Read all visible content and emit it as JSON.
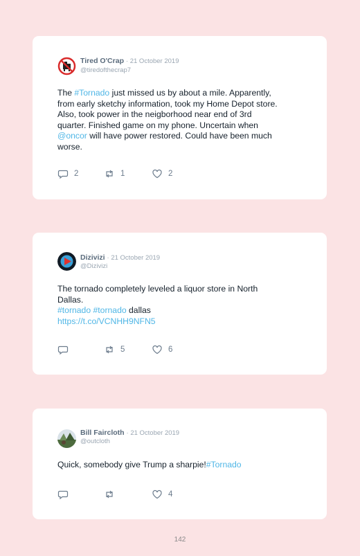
{
  "tweets": [
    {
      "name": "Tired O'Crap",
      "date": "· 21 October 2019",
      "handle": "@tiredofthecrap7",
      "body": {
        "l1_pre": "The ",
        "l1_tag": "#Tornado",
        "l1_post": " just missed us by about a mile. Apparently,",
        "l2": "from early sketchy information, took my Home Depot store.",
        "l3": "Also, took power in the neigborhood near end of 3rd",
        "l4": "quarter. Finished game on my phone. Uncertain when",
        "l5_mention": "@oncor",
        "l5_post": " will have power restored. Could have been much",
        "l6": "worse."
      },
      "replies": "2",
      "retweets": "1",
      "likes": "2"
    },
    {
      "name": "Dizivizi",
      "date": "· 21 October 2019",
      "handle": "@Dizivizi",
      "body": {
        "l1": "The tornado completely leveled a liquor store in North",
        "l2": "Dallas.",
        "l3_tag1": "#tornado",
        "l3_tag2": "#tornado",
        "l3_post": " dallas",
        "l4_link": "https://t.co/VCNHH9NFN5"
      },
      "replies": "",
      "retweets": "5",
      "likes": "6"
    },
    {
      "name": "Bill Faircloth",
      "date": "· 21 October 2019",
      "handle": "@outcloth",
      "body": {
        "l1_pre": "Quick, somebody give Trump a sharpie!",
        "l1_tag": "#Tornado"
      },
      "replies": "",
      "retweets": "",
      "likes": "4"
    }
  ],
  "page_number": "142",
  "icons": {
    "reply": "reply-icon",
    "retweet": "retweet-icon",
    "like": "heart-icon"
  },
  "colors": {
    "background": "#fbe3e4",
    "link": "#4fb6e6"
  }
}
